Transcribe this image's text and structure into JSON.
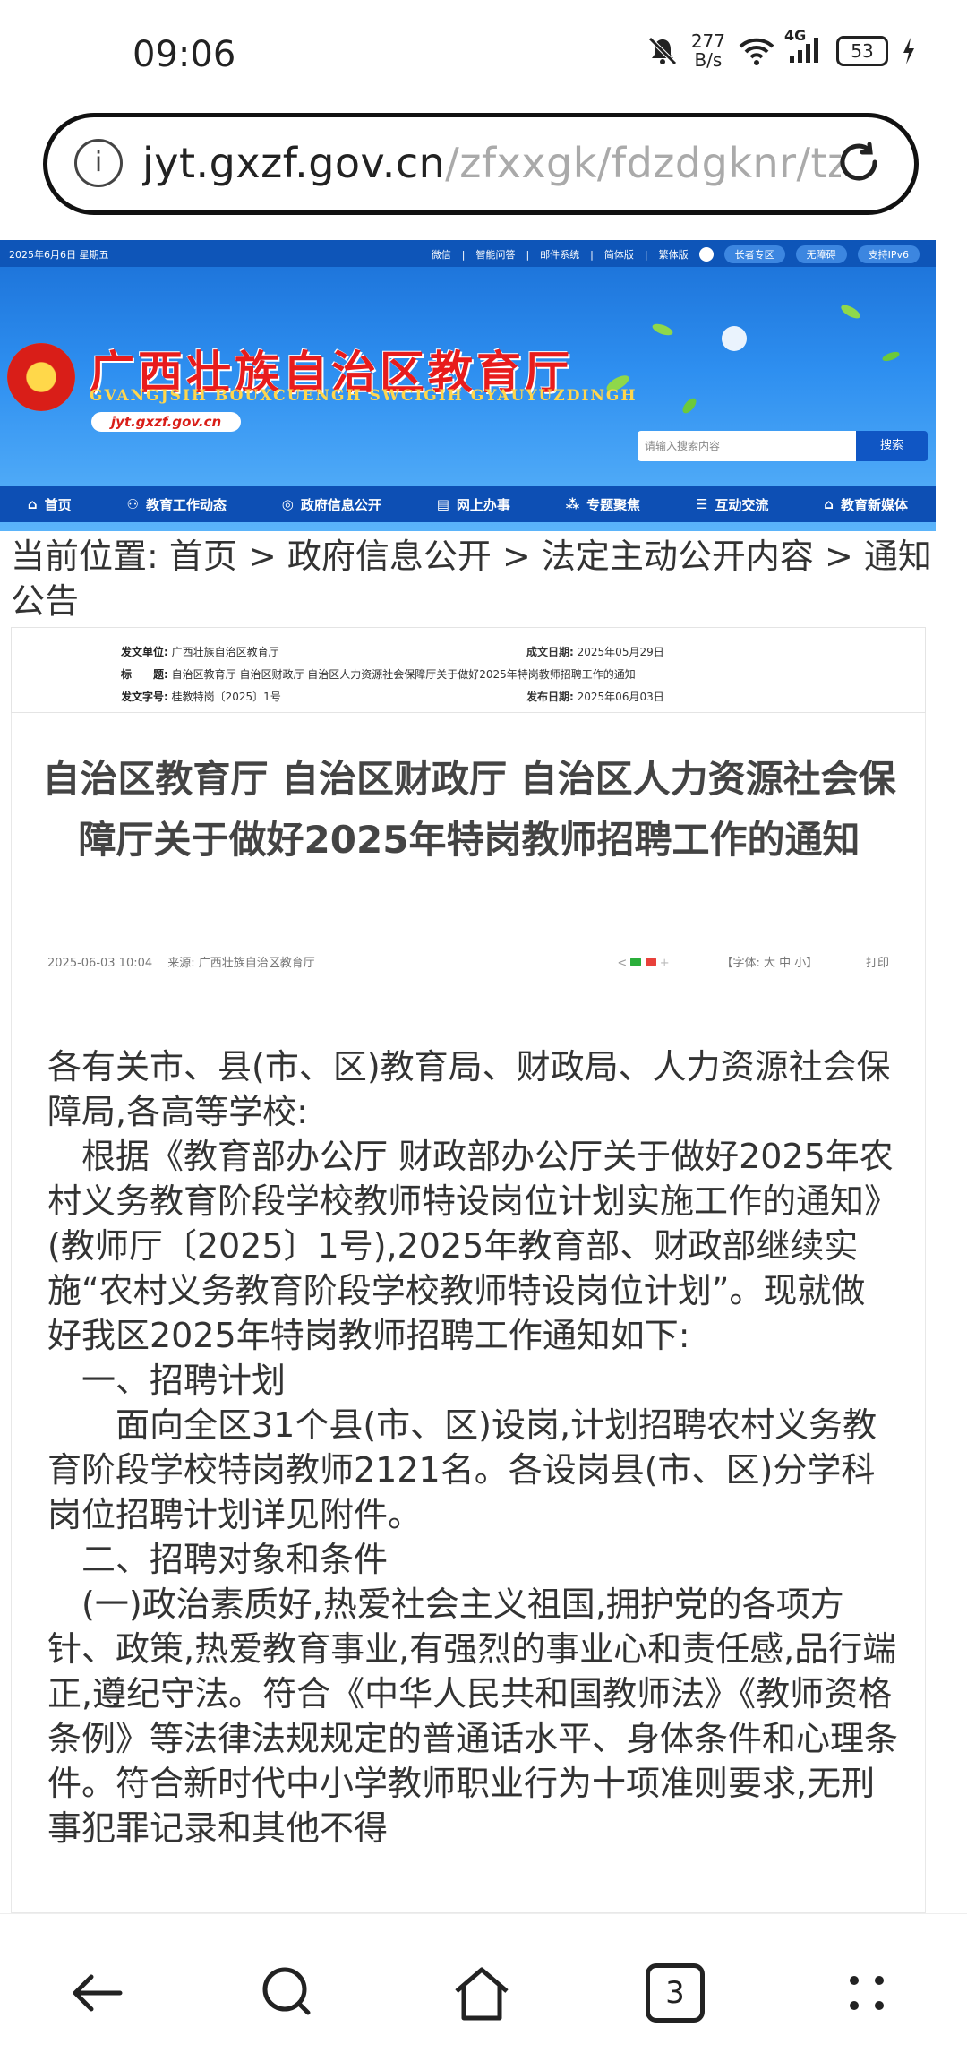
{
  "status_bar": {
    "time": "09:06",
    "net_speed_value": "277",
    "net_speed_unit": "B/s",
    "network": "4G",
    "battery": "53"
  },
  "browser": {
    "url_main": "jyt.gxzf.gov.cn",
    "url_rest": "/zfxxgk/fdzdgknr/tz",
    "tab_count": "3"
  },
  "site_header": {
    "date": "2025年6月6日 星期五",
    "top_links": [
      "微信",
      "智能问答",
      "邮件系统",
      "简体版",
      "繁体版"
    ],
    "pills": [
      "长者专区",
      "无障碍",
      "支持IPv6"
    ],
    "title": "广西壮族自治区教育厅",
    "subtitle": "GVANGJSIH BOUXCUENGH SWCIGIH GYAUYUZDINGH",
    "domain": "jyt.gxzf.gov.cn",
    "search_placeholder": "请输入搜索内容",
    "search_button": "搜索",
    "nav": [
      "首页",
      "教育工作动态",
      "政府信息公开",
      "网上办事",
      "专题聚焦",
      "互动交流",
      "教育新媒体"
    ]
  },
  "breadcrumb": "当前位置:  首页 > 政府信息公开 > 法定主动公开内容 > 通知公告",
  "info": {
    "unit_label": "发文单位:",
    "unit": "广西壮族自治区教育厅",
    "date_label": "成文日期:",
    "date": "2025年05月29日",
    "title_label": "标　　题:",
    "title": "自治区教育厅 自治区财政厅 自治区人力资源社会保障厅关于做好2025年特岗教师招聘工作的通知",
    "docno_label": "发文字号:",
    "docno": "桂教特岗〔2025〕1号",
    "pubdate_label": "发布日期:",
    "pubdate": "2025年06月03日"
  },
  "article": {
    "title": "自治区教育厅 自治区财政厅 自治区人力资源社会保障厅关于做好2025年特岗教师招聘工作的通知",
    "meta_left": "2025-06-03 10:04　 来源:  广西壮族自治区教育厅",
    "meta_font": "【字体:  大  中  小】",
    "meta_print": "打印",
    "paragraphs": [
      "各有关市、县(市、区)教育局、财政局、人力资源社会保障局,各高等学校:",
      "　根据《教育部办公厅 财政部办公厅关于做好2025年农村义务教育阶段学校教师特设岗位计划实施工作的通知》(教师厅〔2025〕1号),2025年教育部、财政部继续实施“农村义务教育阶段学校教师特设岗位计划”。现就做好我区2025年特岗教师招聘工作通知如下:",
      "　一、招聘计划",
      "　　面向全区31个县(市、区)设岗,计划招聘农村义务教育阶段学校特岗教师2121名。各设岗县(市、区)分学科岗位招聘计划详见附件。",
      "　二、招聘对象和条件",
      "　(一)政治素质好,热爱社会主义祖国,拥护党的各项方针、政策,热爱教育事业,有强烈的事业心和责任感,品行端正,遵纪守法。符合《中华人民共和国教师法》《教师资格条例》等法律法规规定的普通话水平、身体条件和心理条件。符合新时代中小学教师职业行为十项准则要求,无刑事犯罪记录和其他不得"
    ]
  }
}
